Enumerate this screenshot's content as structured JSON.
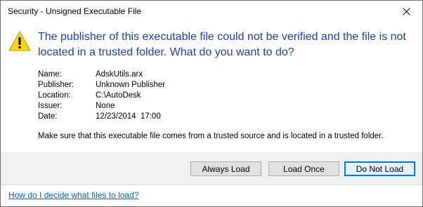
{
  "window": {
    "title": "Security - Unsigned Executable File"
  },
  "icons": {
    "warning": "warning-triangle-icon",
    "close": "close-icon"
  },
  "colors": {
    "headline": "#1c3fa3",
    "link": "#0066cc",
    "default_button_border": "#0078d7",
    "warning_yellow": "#ffd800"
  },
  "headline": "The publisher of this executable file could not be verified and the file is not located in a trusted folder. What do you want to do?",
  "info": [
    {
      "label": "Name:",
      "value": "AdskUtils.arx"
    },
    {
      "label": "Publisher:",
      "value": "Unknown Publisher"
    },
    {
      "label": "Location:",
      "value": "C:\\AutoDesk"
    },
    {
      "label": "Issuer:",
      "value": "None"
    },
    {
      "label": "Date:",
      "value": "12/23/2014  17:00"
    }
  ],
  "advice": "Make sure that this executable file comes from a trusted source and is located in a trusted folder.",
  "buttons": {
    "always_load": "Always Load",
    "load_once": "Load Once",
    "do_not_load": "Do Not Load"
  },
  "help_link": "How do I decide what files to load?"
}
